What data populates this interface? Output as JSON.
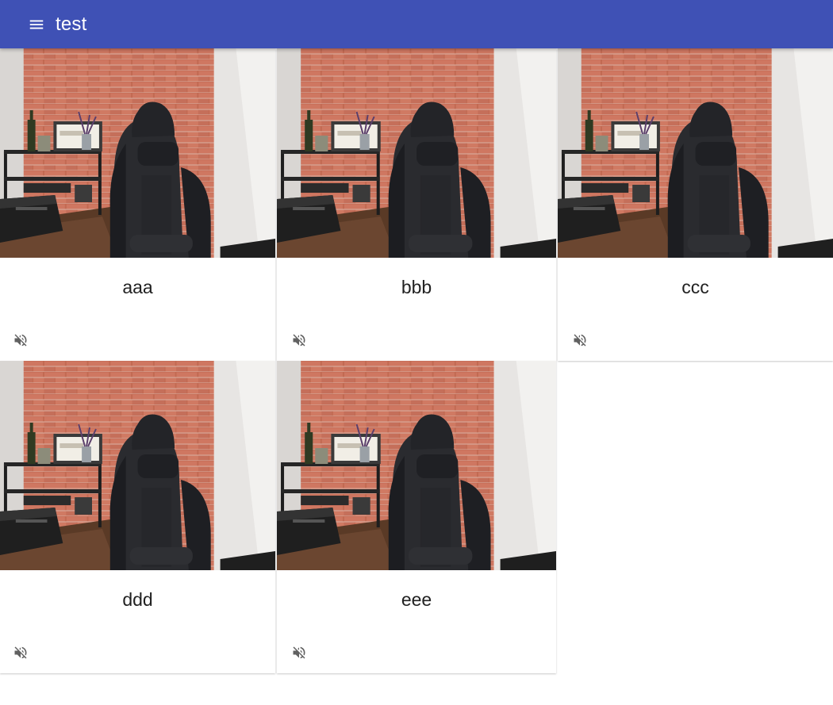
{
  "app_bar": {
    "title": "test",
    "menu_icon": "menu-icon",
    "color": "#3f51b5"
  },
  "cards": [
    {
      "name": "aaa",
      "audio_icon": "volume-off-icon"
    },
    {
      "name": "bbb",
      "audio_icon": "volume-off-icon"
    },
    {
      "name": "ccc",
      "audio_icon": "volume-off-icon"
    },
    {
      "name": "ddd",
      "audio_icon": "volume-off-icon"
    },
    {
      "name": "eee",
      "audio_icon": "volume-off-icon"
    }
  ]
}
